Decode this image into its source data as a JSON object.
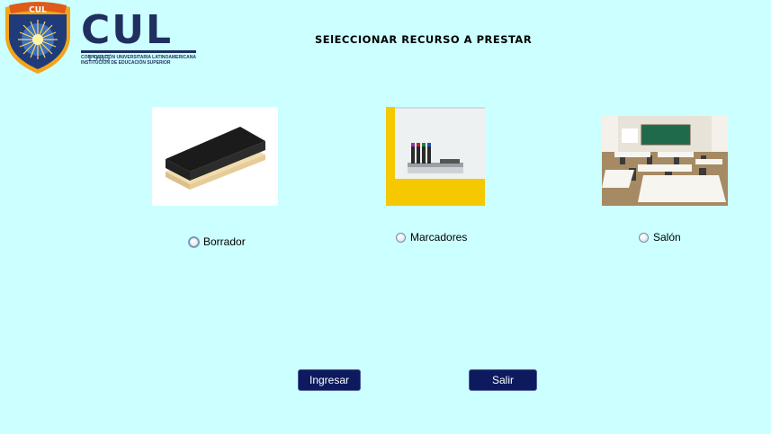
{
  "logo": {
    "badge_text": "CUL",
    "name": "CUL",
    "line1": "CORPORACIÓN UNIVERSITARIA LATINOAMERICANA",
    "line2": "INSTITUCIÓN DE EDUCACIÓN SUPERIOR",
    "year": "1965"
  },
  "page_title": "SElECCIONAR RECURSO A PRESTAR",
  "resources": [
    {
      "label": "Borrador",
      "selected": false
    },
    {
      "label": "Marcadores",
      "selected": false
    },
    {
      "label": "Salón",
      "selected": false
    }
  ],
  "buttons": {
    "ingresar": "Ingresar",
    "salir": "Salir"
  },
  "colors": {
    "background": "#ccffff",
    "button_bg": "#0d1a5e",
    "logo_navy": "#1f2f5f",
    "logo_gold": "#f2a51a"
  }
}
